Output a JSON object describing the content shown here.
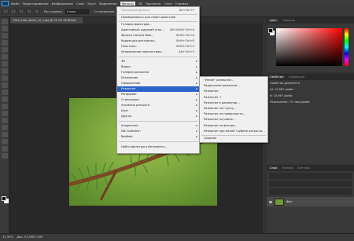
{
  "menubar": {
    "items": [
      "Файл",
      "Редактирование",
      "Изображение",
      "Слои",
      "Текст",
      "Выделение",
      "Фильтр",
      "3D",
      "Просмотр",
      "Окно",
      "Справка"
    ],
    "active_index": 6
  },
  "options": {
    "feather_label": "Растушевка:",
    "feather_value": "0 пикс",
    "smoothing_label": "Сглаживание",
    "style_label": "Стиль:",
    "style_value": "Обычный"
  },
  "document": {
    "tab_label": "Olive_Foto_Stoke_10_2.jpg @ 33,3% (RGB/8#)"
  },
  "filter_menu": {
    "last_filter": "Последний фильтр",
    "last_filter_shortcut": "Alt+Ctrl+F",
    "convert_smart": "Преобразовать для смарт-фильтров",
    "gallery": "Галерея фильтров...",
    "adaptive_wide": "Адаптивный широкий угол...",
    "adaptive_wide_shortcut": "Alt+Shift+Ctrl+A",
    "camera_raw": "Фильтр Camera Raw...",
    "camera_raw_shortcut": "Shift+Ctrl+A",
    "lens_correction": "Коррекция дисторсии...",
    "lens_correction_shortcut": "Shift+Ctrl+R",
    "liquify": "Пластика...",
    "liquify_shortcut": "Shift+Ctrl+X",
    "vanishing_point": "Исправление перспективы...",
    "vanishing_point_shortcut": "Alt+Ctrl+V",
    "3d": "3D",
    "video": "Видео",
    "blur_gallery": "Галерея размытия",
    "distort": "Искажение",
    "render": "Оформление",
    "blur": "Размытие",
    "render2": "Рендеринг",
    "stylize": "Стилизация",
    "sharpen": "Усиление резкости",
    "noise": "Шум",
    "other": "Другое",
    "imagenomic": "Imagenomic",
    "nik": "Nik Collection",
    "redfield": "Redfield",
    "find_online": "Найти фильтры в Интернете..."
  },
  "blur_submenu": {
    "items": [
      "\"Умное\" размытие...",
      "Радиальное размытие...",
      "Размытие",
      "Размытие +",
      "Размытие в движении...",
      "Размытие по Гауссу...",
      "Размытие по поверхности...",
      "Размытие по рамке...",
      "Размытие по фигуре...",
      "Размытие при малой глубине резкости...",
      "Среднее"
    ]
  },
  "panels": {
    "color_tab": "Цвет",
    "swatches_tab": "Образцы",
    "properties_tab": "Свойства",
    "corrections_tab": "Коррекция",
    "doc_props": "Свойства документа",
    "width_label": "Ш: 10,667 дюйм",
    "height_label": "В: 10,667 дюйм",
    "resolution_label": "Разрешение: 72 пикс/дюйм",
    "layers_tab": "Слои",
    "channels_tab": "Каналы",
    "paths_tab": "Контуры",
    "layer_name": "Фон"
  },
  "status": {
    "zoom": "33,33%",
    "doc_size": "Док: 9,23M/9,23M"
  }
}
